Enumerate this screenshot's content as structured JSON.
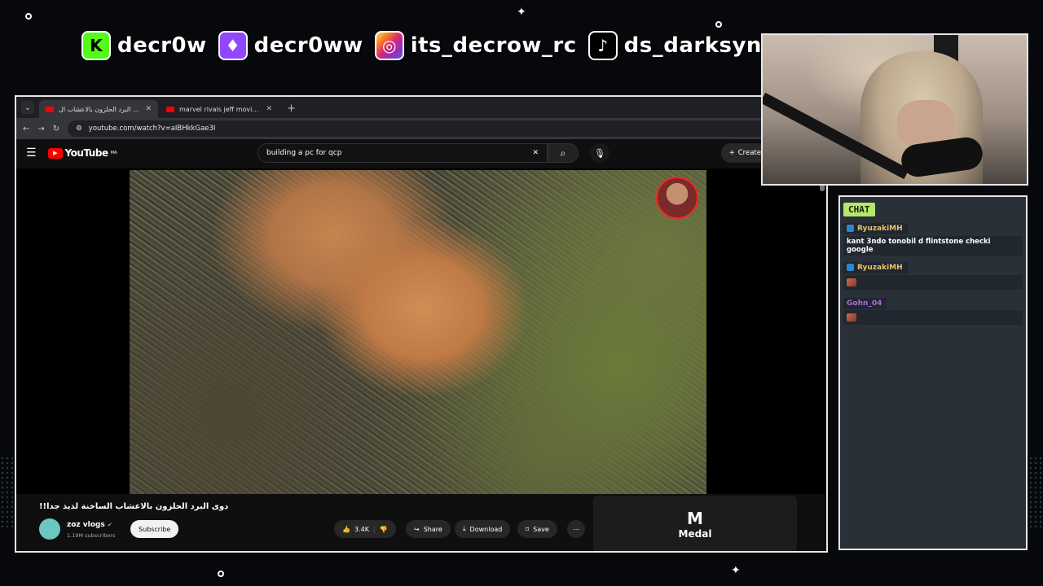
{
  "socials": [
    {
      "icon": "kick-icon",
      "glyph": "K",
      "handle": "decr0w"
    },
    {
      "icon": "twitch-icon",
      "glyph": "♦",
      "handle": "decr0ww"
    },
    {
      "icon": "instagram-icon",
      "glyph": "◎",
      "handle": "its_decrow_rc"
    },
    {
      "icon": "tiktok-icon",
      "glyph": "♪",
      "handle": "ds_darksync"
    }
  ],
  "browser": {
    "tabs": [
      {
        "title": "دوي البرد الحلزون بالاعشاب ال",
        "active": true
      },
      {
        "title": "marvel rivals jeff moving back",
        "active": false
      }
    ],
    "url": "youtube.com/watch?v=aIBHkkGae3I"
  },
  "youtube": {
    "logo": "YouTube",
    "region": "MA",
    "search_query": "building a pc for qcp",
    "create_label": "Create",
    "video": {
      "title": "دوى البرد الحلزون بالاعشاب الساخنة لذيذ جدا!!",
      "channel": "zoz vlogs",
      "verified": "✔",
      "subscribers": "1.19M subscribers",
      "subscribe_label": "Subscribe",
      "likes": "3.4K",
      "share_label": "Share",
      "download_label": "Download",
      "save_label": "Save"
    },
    "medal": {
      "logo": "M",
      "label": "Medal"
    }
  },
  "chat": {
    "header": "CHAT",
    "messages": [
      {
        "user": "RyuzakiMH",
        "user_color": "#e8c36a",
        "text": "kant 3ndo tonobil d flintstone checki google",
        "emote": false
      },
      {
        "user": "RyuzakiMH",
        "user_color": "#e8c36a",
        "text": "",
        "emote": true
      },
      {
        "user": "Gohn_04",
        "user_color": "#b06bd9",
        "text": "",
        "emote": true
      }
    ]
  }
}
